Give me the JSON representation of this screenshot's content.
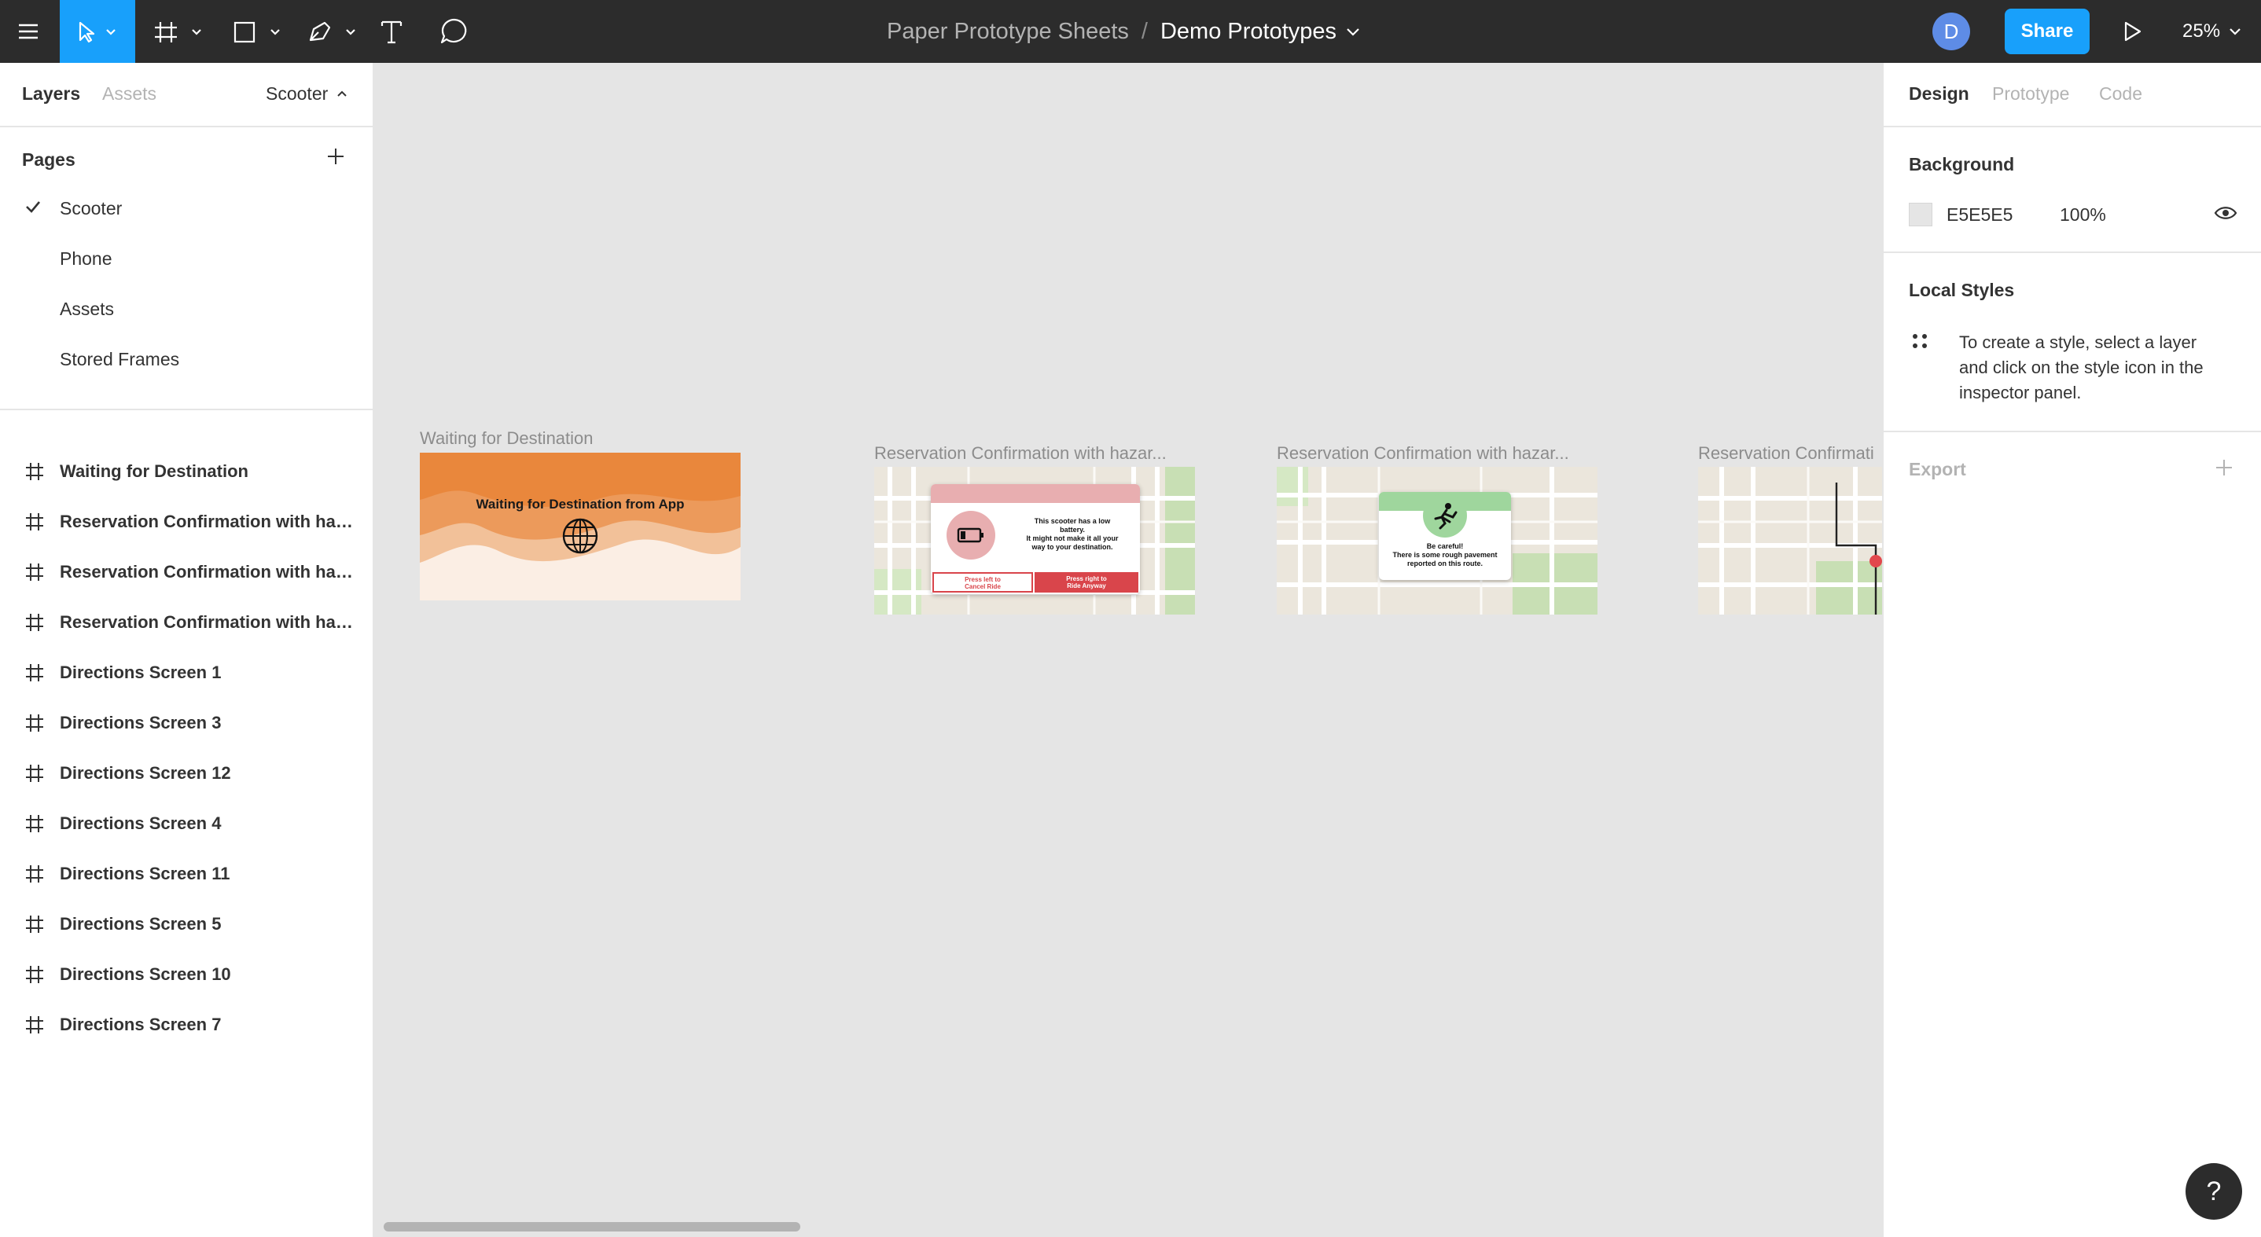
{
  "toolbar": {
    "menu_icon": "hamburger-icon",
    "move_tool_icon": "cursor-icon",
    "frame_tool_icon": "frame-hash-icon",
    "shape_tool_icon": "rectangle-icon",
    "pen_tool_icon": "pen-icon",
    "text_tool_icon": "text-icon",
    "comment_tool_icon": "comment-icon",
    "project_name": "Paper Prototype Sheets",
    "separator": "/",
    "file_name": "Demo Prototypes",
    "avatar_initial": "D",
    "share_label": "Share",
    "present_icon": "play-icon",
    "zoom": "25%",
    "accent_color": "#18a0fb"
  },
  "left_panel": {
    "tabs": [
      "Layers",
      "Assets"
    ],
    "current_page_label": "Scooter",
    "pages_heading": "Pages",
    "pages": [
      "Scooter",
      "Phone",
      "Assets",
      "Stored Frames"
    ],
    "selected_page": "Scooter",
    "layers": [
      "Waiting for Destination",
      "Reservation Confirmation with hazard",
      "Reservation Confirmation with hazard",
      "Reservation Confirmation with hazard",
      "Directions Screen 1",
      "Directions Screen 3",
      "Directions Screen 12",
      "Directions Screen 4",
      "Directions Screen 11",
      "Directions Screen 5",
      "Directions Screen 10",
      "Directions Screen 7"
    ]
  },
  "canvas": {
    "background": "#e5e5e5",
    "frames": [
      {
        "label": "Waiting for Destination",
        "heading": "Waiting for Destination from App"
      },
      {
        "label": "Reservation Confirmation with hazar...",
        "card_lines": [
          "This scooter has a low",
          "battery.",
          "It might not make it all your",
          "way to your destination."
        ],
        "left_button": [
          "Press left to",
          "Cancel Ride"
        ],
        "right_button": [
          "Press right to",
          "Ride Anyway"
        ]
      },
      {
        "label": "Reservation Confirmation with hazar...",
        "card_lines": [
          "Be careful!",
          "There is some rough pavement",
          "reported on this route."
        ]
      },
      {
        "label": "Reservation Confirmati"
      }
    ]
  },
  "right_panel": {
    "tabs": [
      "Design",
      "Prototype",
      "Code"
    ],
    "background_heading": "Background",
    "background_hex": "E5E5E5",
    "background_opacity": "100%",
    "local_styles_heading": "Local Styles",
    "local_styles_hint": [
      "To create a style, select a layer",
      "and click on the style icon in the",
      "inspector panel."
    ],
    "export_heading": "Export",
    "help_label": "?"
  }
}
